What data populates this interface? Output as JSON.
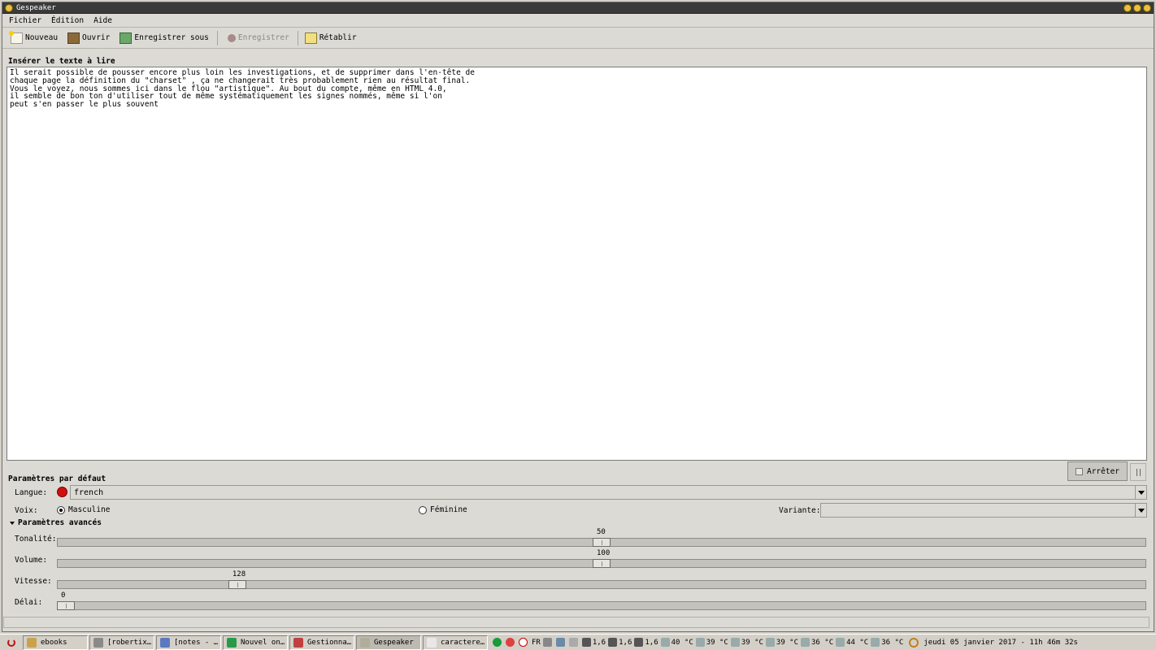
{
  "window": {
    "title": "Gespeaker"
  },
  "menu": [
    "Fichier",
    "Édition",
    "Aide"
  ],
  "toolbar": {
    "new": "Nouveau",
    "open": "Ouvrir",
    "save_as": "Enregistrer sous",
    "save": "Enregistrer",
    "revert": "Rétablir"
  },
  "editor": {
    "label": "Insérer le texte à lire",
    "text": "Il serait possible de pousser encore plus loin les investigations, et de supprimer dans l'en-tête de\nchaque page la définition du \"charset\" , ça ne changerait très probablement rien au résultat final.\nVous le voyez, nous sommes ici dans le flou \"artistique\". Au bout du compte, même en HTML 4.0,\nil semble de bon ton d'utiliser tout de même systématiquement les signes nommés, même si l'on\npeut s'en passer le plus souvent"
  },
  "controls": {
    "stop": "Arrêter",
    "defaults_label": "Paramètres par défaut",
    "language_label": "Langue:",
    "language_value": "french",
    "voice_label": "Voix:",
    "voice_male": "Masculine",
    "voice_female": "Féminine",
    "voice_selected": "male",
    "variant_label": "Variante:",
    "variant_value": "",
    "advanced_label": "Paramètres avancés",
    "pitch_label": "Tonalité:",
    "pitch_value": "50",
    "pitch_fraction": 0.5,
    "volume_label": "Volume:",
    "volume_value": "100",
    "volume_fraction": 0.5,
    "speed_label": "Vitesse:",
    "speed_value": "128",
    "speed_fraction": 0.16,
    "delay_label": "Délai:",
    "delay_value": "0",
    "delay_fraction": 0.0
  },
  "taskbar": {
    "tasks": [
      {
        "label": "ebooks",
        "color": "#caa24a"
      },
      {
        "label": "[robertix…",
        "color": "#8a8a8a"
      },
      {
        "label": "[notes - …",
        "color": "#5a7ac0"
      },
      {
        "label": "Nouvel on…",
        "color": "#2a9a4a"
      },
      {
        "label": "Gestionna…",
        "color": "#c04040"
      },
      {
        "label": "Gespeaker",
        "color": "#b0ae9a"
      },
      {
        "label": "caractere…",
        "color": "#e8e8e8"
      }
    ],
    "active": "Gespeaker",
    "tray": {
      "lang": "FR",
      "cpu1": "1,6",
      "cpu2": "1,6",
      "cpu3": "1,6",
      "temps": [
        "40 °C",
        "39 °C",
        "39 °C",
        "39 °C",
        "36 °C",
        "44 °C",
        "36 °C"
      ]
    },
    "clock": "jeudi 05 janvier 2017 - 11h 46m 32s"
  }
}
